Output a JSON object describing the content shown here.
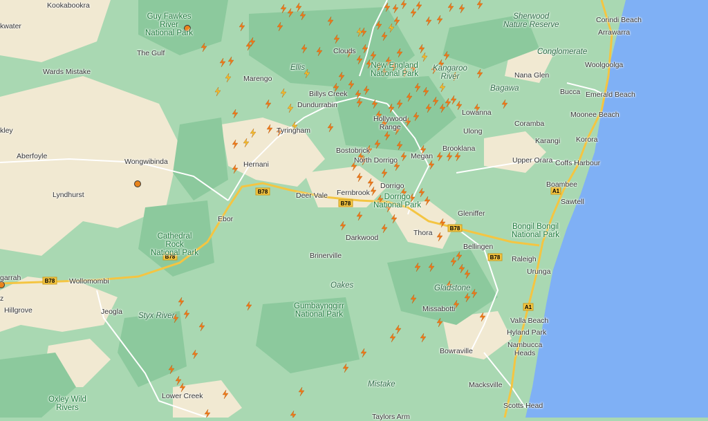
{
  "colors": {
    "land_light": "#f3ead6",
    "forest": "#a9d8b2",
    "forest_dark": "#8cc99d",
    "ocean": "#7fb0f5",
    "road_major": "#f4c542",
    "road_minor": "#ffffff",
    "strike_orange": "#f07a1a",
    "strike_yellow": "#f2c12e",
    "marker": "#e8841c"
  },
  "icons": {
    "strike": "lightning-bolt-icon",
    "marker": "location-dot-icon"
  },
  "labels": {
    "kookabookra": "Kookabookra",
    "kwater": "kwater",
    "guy_fawkes": "Guy Fawkes\nRiver\nNational Park",
    "the_gulf": "The Gulf",
    "wards_mistake": "Wards Mistake",
    "marengo": "Marengo",
    "ellis": "Ellis",
    "clouds": "Clouds",
    "billys_creek": "Billys Creek",
    "dundurrabin": "Dundurrabin",
    "tyringham": "Tyringham",
    "kley": "kley",
    "aberfoyle": "Aberfoyle",
    "wongwibinda": "Wongwibinda",
    "lyndhurst": "Lyndhurst",
    "hernani": "Hernani",
    "bostobrick": "Bostobrick",
    "dorrigo_n": "North Dorrigo",
    "megan": "Megan",
    "brooklana": "Brooklana",
    "sherwood": "Sherwood\nNature Reserve",
    "corindi": "Corindi Beach",
    "arrawarra": "Arrawarra",
    "conglomerate": "Conglomerate",
    "woolgoolga": "Woolgoolga",
    "nana_glen": "Nana Glen",
    "bucca": "Bucca",
    "emerald": "Emerald Beach",
    "bagawa": "Bagawa",
    "moonee": "Moonee Beach",
    "lowanna": "Lowanna",
    "ulong": "Ulong",
    "coramba": "Coramba",
    "karangi": "Karangi",
    "korora": "Korora",
    "upper_orara": "Upper Orara",
    "coffs": "Coffs Harbour",
    "boambee": "Boambee",
    "sawtell": "Sawtell",
    "glenniffer": "Gleniffer",
    "bongil": "Bongil Bongil\nNational Park",
    "fernbrook": "Fernbrook",
    "deer_vale": "Deer Vale",
    "dorrigo": "Dorrigo",
    "dorrigo_np": "Dorrigo\nNational Park",
    "ebor": "Ebor",
    "darkwood": "Darkwood",
    "thora": "Thora",
    "bellingen": "Bellingen",
    "raleigh": "Raleigh",
    "urunga": "Urunga",
    "brinerville": "Brinerville",
    "oakes": "Oakes",
    "gladstone": "Gladstone",
    "cathedral": "Cathedral\nRock\nNational Park",
    "garrah": "garrah",
    "wollomombi": "Wollomombi",
    "hillgrove": "Hillgrove",
    "jeogla": "Jeogla",
    "styx": "Styx River",
    "gumbaynggirr": "Gumbaynggirr\nNational Park",
    "missabotti": "Missabotti",
    "valla": "Valla Beach",
    "hyland": "Hyland Park",
    "nambucca": "Nambucca\nHeads",
    "bowraville": "Bowraville",
    "mistake": "Mistake",
    "macksville": "Macksville",
    "scotts": "Scotts Head",
    "lower_creek": "Lower Creek",
    "oxley": "Oxley Wild\nRivers",
    "taylors": "Taylors Arm",
    "kangaroo": "Kangaroo\nRiver",
    "new_england_np": "New England\nNational Park",
    "hollywood": "Hollywood\nRange",
    "z": "z"
  },
  "shields": {
    "b78": "B78",
    "a1": "A1"
  }
}
